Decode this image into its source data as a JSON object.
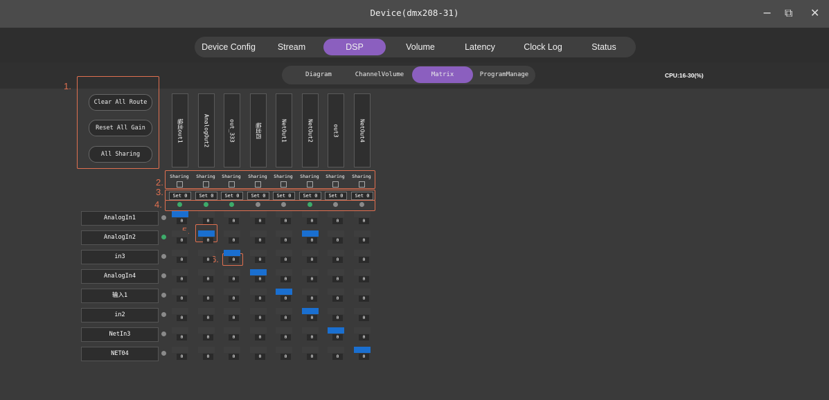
{
  "window": {
    "title": "Device(dmx208-31)",
    "minimize": "−",
    "restore": "⧉",
    "close": "✕"
  },
  "main_tabs": [
    {
      "label": "Device Config",
      "active": false
    },
    {
      "label": "Stream",
      "active": false
    },
    {
      "label": "DSP",
      "active": true
    },
    {
      "label": "Volume",
      "active": false
    },
    {
      "label": "Latency",
      "active": false
    },
    {
      "label": "Clock Log",
      "active": false
    },
    {
      "label": "Status",
      "active": false
    }
  ],
  "sub_tabs": [
    {
      "label": "Diagram",
      "active": false
    },
    {
      "label": "ChannelVolume",
      "active": false
    },
    {
      "label": "Matrix",
      "active": true
    },
    {
      "label": "ProgramManage",
      "active": false
    }
  ],
  "cpu": "CPU:16-30(%)",
  "actions": {
    "clear_all_route": "Clear All Route",
    "reset_all_gain": "Reset All Gain",
    "all_sharing": "All Sharing"
  },
  "annotations": [
    "1.",
    "2.",
    "3.",
    "4.",
    "5.",
    "6."
  ],
  "outputs": [
    {
      "name": "输出out1",
      "sharing": "Sharing",
      "set": "Set 0",
      "status": "green"
    },
    {
      "name": "AnalogOut2",
      "sharing": "Sharing",
      "set": "Set 0",
      "status": "green"
    },
    {
      "name": "out_333",
      "sharing": "Sharing",
      "set": "Set 0",
      "status": "green"
    },
    {
      "name": "输出四",
      "sharing": "Sharing",
      "set": "Set 0",
      "status": "grey"
    },
    {
      "name": "NetOut1",
      "sharing": "Sharing",
      "set": "Set 0",
      "status": "grey"
    },
    {
      "name": "NetOut2",
      "sharing": "Sharing",
      "set": "Set 0",
      "status": "green"
    },
    {
      "name": "out3",
      "sharing": "Sharing",
      "set": "Set 0",
      "status": "grey"
    },
    {
      "name": "NetOut4",
      "sharing": "Sharing",
      "set": "Set 0",
      "status": "grey"
    }
  ],
  "inputs": [
    {
      "name": "AnalogIn1",
      "status": "grey"
    },
    {
      "name": "AnalogIn2",
      "status": "green"
    },
    {
      "name": "in3",
      "status": "grey"
    },
    {
      "name": "AnalogIn4",
      "status": "grey"
    },
    {
      "name": "输入1",
      "status": "grey"
    },
    {
      "name": "in2",
      "status": "grey"
    },
    {
      "name": "NetIn3",
      "status": "grey"
    },
    {
      "name": "NET04",
      "status": "grey"
    }
  ],
  "matrix": {
    "gain_label": "0",
    "routes": [
      [
        1,
        0,
        0,
        0,
        0,
        0,
        0,
        0
      ],
      [
        0,
        1,
        0,
        0,
        0,
        1,
        0,
        0
      ],
      [
        0,
        0,
        1,
        0,
        0,
        0,
        0,
        0
      ],
      [
        0,
        0,
        0,
        1,
        0,
        0,
        0,
        0
      ],
      [
        0,
        0,
        0,
        0,
        1,
        0,
        0,
        0
      ],
      [
        0,
        0,
        0,
        0,
        0,
        1,
        0,
        0
      ],
      [
        0,
        0,
        0,
        0,
        0,
        0,
        1,
        0
      ],
      [
        0,
        0,
        0,
        0,
        0,
        0,
        0,
        1
      ]
    ]
  },
  "colors": {
    "accent": "#8b5fbf",
    "route_on": "#1a6fd0",
    "route_off": "#3e3e3e",
    "status_green": "#3dab6a",
    "status_grey": "#8a8a8a",
    "annotation": "#e07050"
  }
}
